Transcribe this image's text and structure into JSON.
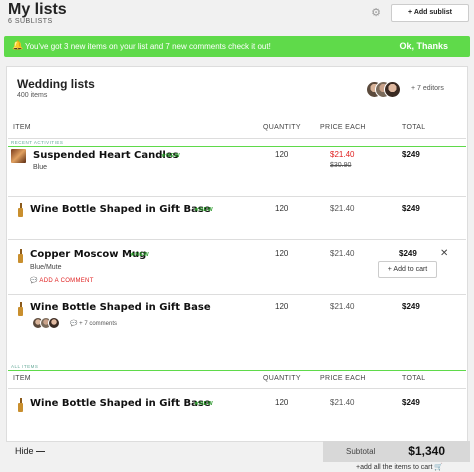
{
  "page": {
    "title": "My lists",
    "subcount": "6 SUBLISTS",
    "gear_icon": "gear-icon",
    "add_sublist_label": "+ Add sublist"
  },
  "banner": {
    "message": "You've got 3 new items on your list and 7 new comments check it out!",
    "ok_label": "Ok, Thanks",
    "icon": "bell-icon",
    "color": "#5fda4a"
  },
  "list": {
    "title": "Wedding lists",
    "items_count": "400 items",
    "editors": "+ 7 editors"
  },
  "columns": {
    "item": "ITEM",
    "quantity": "QUANTITY",
    "price_each": "PRICE EACH",
    "total": "TOTAL"
  },
  "sections": {
    "recent": "RECENT ACTIVITIES",
    "all": "ALL ITEMS"
  },
  "rows": [
    {
      "name": "Suspended Heart Candles",
      "badge": "NEW",
      "variant": "Blue",
      "qty": "120",
      "price": "$21.40",
      "old_price": "$30.90",
      "total": "$249"
    },
    {
      "name": "Wine Bottle Shaped in Gift Base",
      "badge": "NEW",
      "qty": "120",
      "price": "$21.40",
      "total": "$249"
    },
    {
      "name": "Copper Moscow Mug",
      "badge": "NEW",
      "variant": "Blue/Mute",
      "add_comment": "ADD A COMMENT",
      "qty": "120",
      "price": "$21.40",
      "total": "$249",
      "add_to_cart": "+ Add to cart",
      "close": "✕"
    },
    {
      "name": "Wine Bottle Shaped in Gift Base",
      "comments": "+ 7 comments",
      "qty": "120",
      "price": "$21.40",
      "total": "$249"
    },
    {
      "name": "Wine Bottle Shaped in Gift Base",
      "badge": "NEW",
      "qty": "120",
      "price": "$21.40",
      "total": "$249"
    }
  ],
  "footer": {
    "hide_label": "Hide",
    "subtotal_label": "Subtotal",
    "subtotal_value": "$1,340",
    "add_all_label": "+add all the items to cart"
  }
}
